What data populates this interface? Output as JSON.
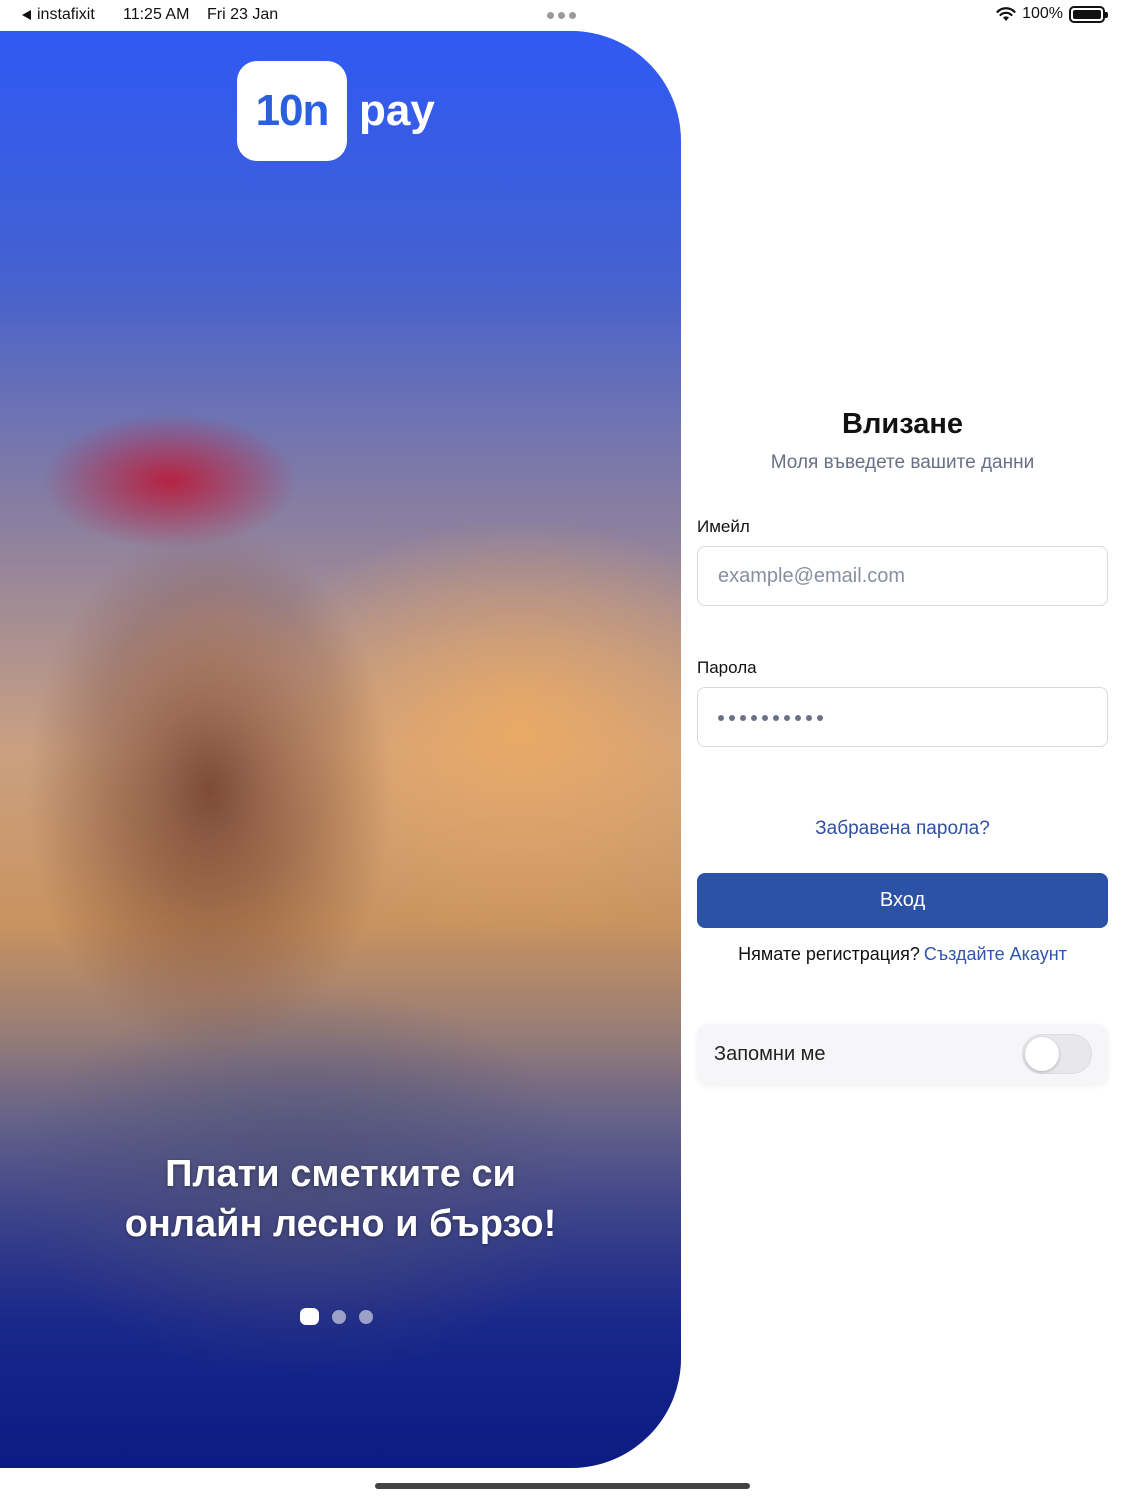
{
  "status_bar": {
    "back_app": "instafixit",
    "time": "11:25 AM",
    "date": "Fri 23 Jan",
    "battery": "100%",
    "icons": [
      "back-arrow-icon",
      "wifi-icon",
      "battery-icon"
    ]
  },
  "hero": {
    "logo_mark": "10n",
    "logo_text": "pay",
    "tagline_line1": "Плати сметките си",
    "tagline_line2": "онлайн лесно и бързо!",
    "pager": {
      "pages": 3,
      "active": 1
    }
  },
  "login": {
    "title": "Влизане",
    "subtitle": "Моля въведете вашите данни",
    "email_label": "Имейл",
    "email_placeholder": "example@email.com",
    "email_value": "",
    "password_label": "Парола",
    "password_masked_length": 10,
    "forgot_link": "Забравена парола?",
    "submit_label": "Вход",
    "no_account_text": "Нямате регистрация?",
    "signup_link": "Създайте Акаунт",
    "remember_label": "Запомни ме",
    "remember_on": false
  },
  "colors": {
    "primary": "#2c52a6",
    "link": "#2f55b0",
    "hero_top": "#3559e8",
    "hero_bottom": "#0e1f86"
  }
}
